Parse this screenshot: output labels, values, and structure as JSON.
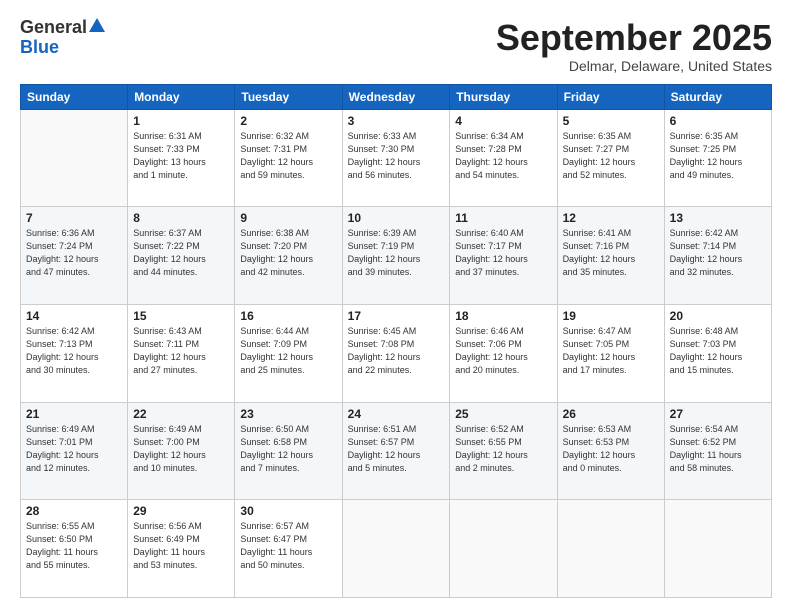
{
  "header": {
    "logo_general": "General",
    "logo_blue": "Blue",
    "month": "September 2025",
    "location": "Delmar, Delaware, United States"
  },
  "weekdays": [
    "Sunday",
    "Monday",
    "Tuesday",
    "Wednesday",
    "Thursday",
    "Friday",
    "Saturday"
  ],
  "weeks": [
    [
      {
        "day": "",
        "info": ""
      },
      {
        "day": "1",
        "info": "Sunrise: 6:31 AM\nSunset: 7:33 PM\nDaylight: 13 hours\nand 1 minute."
      },
      {
        "day": "2",
        "info": "Sunrise: 6:32 AM\nSunset: 7:31 PM\nDaylight: 12 hours\nand 59 minutes."
      },
      {
        "day": "3",
        "info": "Sunrise: 6:33 AM\nSunset: 7:30 PM\nDaylight: 12 hours\nand 56 minutes."
      },
      {
        "day": "4",
        "info": "Sunrise: 6:34 AM\nSunset: 7:28 PM\nDaylight: 12 hours\nand 54 minutes."
      },
      {
        "day": "5",
        "info": "Sunrise: 6:35 AM\nSunset: 7:27 PM\nDaylight: 12 hours\nand 52 minutes."
      },
      {
        "day": "6",
        "info": "Sunrise: 6:35 AM\nSunset: 7:25 PM\nDaylight: 12 hours\nand 49 minutes."
      }
    ],
    [
      {
        "day": "7",
        "info": "Sunrise: 6:36 AM\nSunset: 7:24 PM\nDaylight: 12 hours\nand 47 minutes."
      },
      {
        "day": "8",
        "info": "Sunrise: 6:37 AM\nSunset: 7:22 PM\nDaylight: 12 hours\nand 44 minutes."
      },
      {
        "day": "9",
        "info": "Sunrise: 6:38 AM\nSunset: 7:20 PM\nDaylight: 12 hours\nand 42 minutes."
      },
      {
        "day": "10",
        "info": "Sunrise: 6:39 AM\nSunset: 7:19 PM\nDaylight: 12 hours\nand 39 minutes."
      },
      {
        "day": "11",
        "info": "Sunrise: 6:40 AM\nSunset: 7:17 PM\nDaylight: 12 hours\nand 37 minutes."
      },
      {
        "day": "12",
        "info": "Sunrise: 6:41 AM\nSunset: 7:16 PM\nDaylight: 12 hours\nand 35 minutes."
      },
      {
        "day": "13",
        "info": "Sunrise: 6:42 AM\nSunset: 7:14 PM\nDaylight: 12 hours\nand 32 minutes."
      }
    ],
    [
      {
        "day": "14",
        "info": "Sunrise: 6:42 AM\nSunset: 7:13 PM\nDaylight: 12 hours\nand 30 minutes."
      },
      {
        "day": "15",
        "info": "Sunrise: 6:43 AM\nSunset: 7:11 PM\nDaylight: 12 hours\nand 27 minutes."
      },
      {
        "day": "16",
        "info": "Sunrise: 6:44 AM\nSunset: 7:09 PM\nDaylight: 12 hours\nand 25 minutes."
      },
      {
        "day": "17",
        "info": "Sunrise: 6:45 AM\nSunset: 7:08 PM\nDaylight: 12 hours\nand 22 minutes."
      },
      {
        "day": "18",
        "info": "Sunrise: 6:46 AM\nSunset: 7:06 PM\nDaylight: 12 hours\nand 20 minutes."
      },
      {
        "day": "19",
        "info": "Sunrise: 6:47 AM\nSunset: 7:05 PM\nDaylight: 12 hours\nand 17 minutes."
      },
      {
        "day": "20",
        "info": "Sunrise: 6:48 AM\nSunset: 7:03 PM\nDaylight: 12 hours\nand 15 minutes."
      }
    ],
    [
      {
        "day": "21",
        "info": "Sunrise: 6:49 AM\nSunset: 7:01 PM\nDaylight: 12 hours\nand 12 minutes."
      },
      {
        "day": "22",
        "info": "Sunrise: 6:49 AM\nSunset: 7:00 PM\nDaylight: 12 hours\nand 10 minutes."
      },
      {
        "day": "23",
        "info": "Sunrise: 6:50 AM\nSunset: 6:58 PM\nDaylight: 12 hours\nand 7 minutes."
      },
      {
        "day": "24",
        "info": "Sunrise: 6:51 AM\nSunset: 6:57 PM\nDaylight: 12 hours\nand 5 minutes."
      },
      {
        "day": "25",
        "info": "Sunrise: 6:52 AM\nSunset: 6:55 PM\nDaylight: 12 hours\nand 2 minutes."
      },
      {
        "day": "26",
        "info": "Sunrise: 6:53 AM\nSunset: 6:53 PM\nDaylight: 12 hours\nand 0 minutes."
      },
      {
        "day": "27",
        "info": "Sunrise: 6:54 AM\nSunset: 6:52 PM\nDaylight: 11 hours\nand 58 minutes."
      }
    ],
    [
      {
        "day": "28",
        "info": "Sunrise: 6:55 AM\nSunset: 6:50 PM\nDaylight: 11 hours\nand 55 minutes."
      },
      {
        "day": "29",
        "info": "Sunrise: 6:56 AM\nSunset: 6:49 PM\nDaylight: 11 hours\nand 53 minutes."
      },
      {
        "day": "30",
        "info": "Sunrise: 6:57 AM\nSunset: 6:47 PM\nDaylight: 11 hours\nand 50 minutes."
      },
      {
        "day": "",
        "info": ""
      },
      {
        "day": "",
        "info": ""
      },
      {
        "day": "",
        "info": ""
      },
      {
        "day": "",
        "info": ""
      }
    ]
  ]
}
